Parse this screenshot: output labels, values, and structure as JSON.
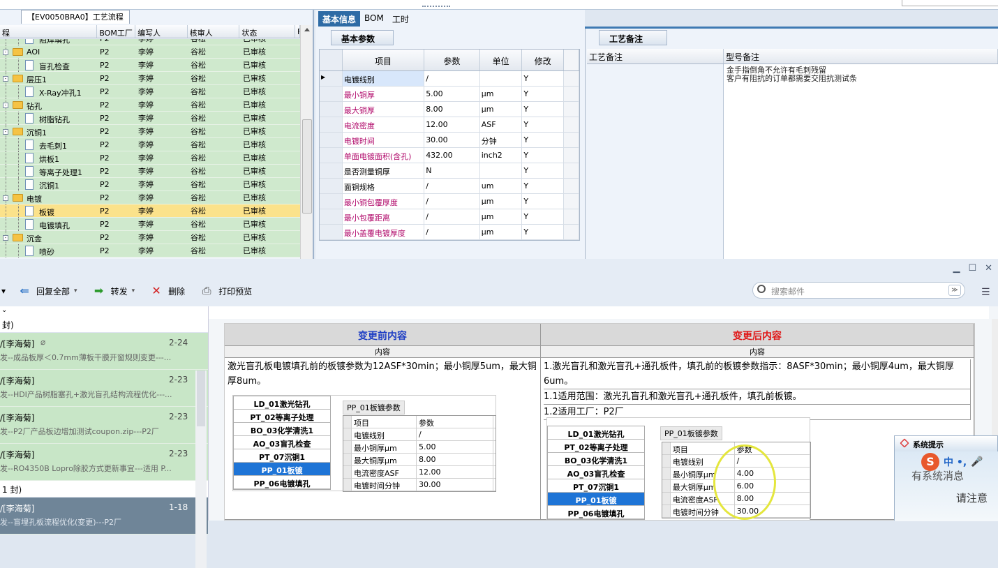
{
  "tree": {
    "tab_title": "【EV0050BRA0】工艺流程",
    "columns": [
      "程",
      "BOM工厂",
      "编写人",
      "核审人",
      "状态",
      "F"
    ],
    "rows": [
      {
        "name": "阻焊填孔",
        "bom": "P2",
        "writer": "李婷",
        "reviewer": "谷松",
        "status": "已审核",
        "type": "doc",
        "level": 1
      },
      {
        "name": "AOI",
        "bom": "P2",
        "writer": "李婷",
        "reviewer": "谷松",
        "status": "已审核",
        "type": "folder",
        "level": 0
      },
      {
        "name": "盲孔检查",
        "bom": "P2",
        "writer": "李婷",
        "reviewer": "谷松",
        "status": "已审核",
        "type": "doc",
        "level": 1
      },
      {
        "name": "层压1",
        "bom": "P2",
        "writer": "李婷",
        "reviewer": "谷松",
        "status": "已审核",
        "type": "folder",
        "level": 0
      },
      {
        "name": "X-Ray冲孔1",
        "bom": "P2",
        "writer": "李婷",
        "reviewer": "谷松",
        "status": "已审核",
        "type": "doc",
        "level": 1
      },
      {
        "name": "钻孔",
        "bom": "P2",
        "writer": "李婷",
        "reviewer": "谷松",
        "status": "已审核",
        "type": "folder",
        "level": 0
      },
      {
        "name": "树脂钻孔",
        "bom": "P2",
        "writer": "李婷",
        "reviewer": "谷松",
        "status": "已审核",
        "type": "doc",
        "level": 1
      },
      {
        "name": "沉铜1",
        "bom": "P2",
        "writer": "李婷",
        "reviewer": "谷松",
        "status": "已审核",
        "type": "folder",
        "level": 0
      },
      {
        "name": "去毛刺1",
        "bom": "P2",
        "writer": "李婷",
        "reviewer": "谷松",
        "status": "已审核",
        "type": "doc",
        "level": 1
      },
      {
        "name": "烘板1",
        "bom": "P2",
        "writer": "李婷",
        "reviewer": "谷松",
        "status": "已审核",
        "type": "doc",
        "level": 1
      },
      {
        "name": "等离子处理1",
        "bom": "P2",
        "writer": "李婷",
        "reviewer": "谷松",
        "status": "已审核",
        "type": "doc",
        "level": 1
      },
      {
        "name": "沉铜1",
        "bom": "P2",
        "writer": "李婷",
        "reviewer": "谷松",
        "status": "已审核",
        "type": "doc",
        "level": 1
      },
      {
        "name": "电镀",
        "bom": "P2",
        "writer": "李婷",
        "reviewer": "谷松",
        "status": "已审核",
        "type": "folder",
        "level": 0
      },
      {
        "name": "板镀",
        "bom": "P2",
        "writer": "李婷",
        "reviewer": "谷松",
        "status": "已审核",
        "type": "doc",
        "level": 1,
        "selected": true
      },
      {
        "name": "电镀填孔",
        "bom": "P2",
        "writer": "李婷",
        "reviewer": "谷松",
        "status": "已审核",
        "type": "doc",
        "level": 1
      },
      {
        "name": "沉金",
        "bom": "P2",
        "writer": "李婷",
        "reviewer": "谷松",
        "status": "已审核",
        "type": "folder",
        "level": 0
      },
      {
        "name": "喷砂",
        "bom": "P2",
        "writer": "李婷",
        "reviewer": "谷松",
        "status": "已审核",
        "type": "doc",
        "level": 1
      }
    ]
  },
  "tabs": [
    "基本信息",
    "BOM",
    "工时"
  ],
  "basic_panel": {
    "title": "基本参数",
    "columns": [
      "项目",
      "参数",
      "单位",
      "修改"
    ],
    "rows": [
      {
        "item": "电镀线别",
        "param": "/",
        "unit": "",
        "mod": "Y",
        "red": false,
        "hl": true
      },
      {
        "item": "最小铜厚",
        "param": "5.00",
        "unit": "μm",
        "mod": "Y",
        "red": true
      },
      {
        "item": "最大铜厚",
        "param": "8.00",
        "unit": "μm",
        "mod": "Y",
        "red": true
      },
      {
        "item": "电流密度",
        "param": "12.00",
        "unit": "ASF",
        "mod": "Y",
        "red": true
      },
      {
        "item": "电镀时间",
        "param": "30.00",
        "unit": "分钟",
        "mod": "Y",
        "red": true
      },
      {
        "item": "单面电镀面积(含孔)",
        "param": "432.00",
        "unit": "inch2",
        "mod": "Y",
        "red": true
      },
      {
        "item": "是否测量铜厚",
        "param": "N",
        "unit": "",
        "mod": "Y",
        "red": false
      },
      {
        "item": "面铜规格",
        "param": "/",
        "unit": "um",
        "mod": "Y",
        "red": false
      },
      {
        "item": "最小铜包覆厚度",
        "param": "/",
        "unit": "μm",
        "mod": "Y",
        "red": true
      },
      {
        "item": "最小包覆距离",
        "param": "/",
        "unit": "μm",
        "mod": "Y",
        "red": true
      },
      {
        "item": "最小盖覆电镀厚度",
        "param": "/",
        "unit": "μm",
        "mod": "Y",
        "red": true
      }
    ]
  },
  "notes_panel": {
    "title": "工艺备注",
    "col1": "工艺备注",
    "col2": "型号备注",
    "note_lines": [
      "金手指倒角不允许有毛刺残留",
      "客户有阻抗的订单都需要交阻抗测试条"
    ]
  },
  "mail": {
    "toolbar": {
      "reply_all": "回复全部",
      "forward": "转发",
      "delete": "删除",
      "print": "打印预览"
    },
    "search_placeholder": "搜索邮件",
    "group1": "封)",
    "group2": "1 封)",
    "items": [
      {
        "from": "/[李海菊]",
        "date": "2-24",
        "subject": "发--成品板厚＜0.7mm薄板干膜开窗规则变更---...",
        "attach": true
      },
      {
        "from": "/[李海菊]",
        "date": "2-23",
        "subject": "发--HDI产品树脂塞孔+激光盲孔结构流程优化---..."
      },
      {
        "from": "/[李海菊]",
        "date": "2-23",
        "subject": "发--P2厂产品板边增加测试coupon.zip---P2厂"
      },
      {
        "from": "/[李海菊]",
        "date": "2-23",
        "subject": "发--RO4350B Lopro除胶方式更新事宜---适用 P..."
      },
      {
        "from": "/[李海菊]",
        "date": "1-18",
        "subject": "发--盲埋孔板流程优化(变更)---P2厂"
      }
    ]
  },
  "change_doc": {
    "before_title": "变更前内容",
    "after_title": "变更后内容",
    "content_label": "内容",
    "before_text": "激光盲孔板电镀填孔前的板镀参数为12ASF*30min；最小铜厚5um，最大铜厚8um。",
    "after_lines": [
      "1.激光盲孔和激光盲孔+通孔板件，填孔前的板镀参数指示：8ASF*30min；最小铜厚4um，最大铜厚6um。",
      "1.1适用范围：激光孔盲孔和激光盲孔+通孔板件，填孔前板镀。",
      "1.2适用工厂：P2厂"
    ],
    "list_items": [
      "LD_01激光钻孔",
      "PT_02等离子处理",
      "BO_03化学清洗1",
      "AO_03盲孔检查",
      "PT_07沉铜1",
      "PP_01板镀",
      "PP_06电镀填孔"
    ],
    "param_title": "PP_01板镀参数",
    "param_cols": [
      "项目",
      "参数"
    ],
    "before_params": [
      [
        "电镀线别",
        "/"
      ],
      [
        "最小铜厚μm",
        "5.00"
      ],
      [
        "最大铜厚μm",
        "8.00"
      ],
      [
        "电流密度ASF",
        "12.00"
      ],
      [
        "电镀时间分钟",
        "30.00"
      ]
    ],
    "after_params": [
      [
        "电镀线别",
        "/"
      ],
      [
        "最小铜厚μm",
        "4.00"
      ],
      [
        "最大铜厚μm",
        "6.00"
      ],
      [
        "电流密度ASF",
        "8.00"
      ],
      [
        "电镀时间分钟",
        "30.00"
      ]
    ]
  },
  "notification": {
    "title": "系统提示",
    "line1": "有系统消息",
    "line2": "请注意"
  },
  "ime": {
    "label": "中 •,"
  }
}
